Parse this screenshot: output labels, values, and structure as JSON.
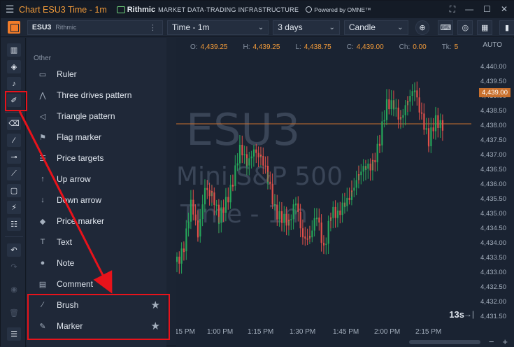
{
  "titlebar": {
    "title": "Chart ESU3 Time - 1m",
    "brand": "Rithmic",
    "brand_sub": "MARKET DATA·TRADING INFRASTRUCTURE",
    "omne": "Powered by OMNE™"
  },
  "toolbar": {
    "symbol": "ESU3",
    "exchange": "Rithmic",
    "timeframe": "Time - 1m",
    "range": "3 days",
    "chart_type": "Candle"
  },
  "panel": {
    "section_label": "Other",
    "items": [
      {
        "label": "Ruler",
        "icon": "ruler-icon",
        "glyph": "▭"
      },
      {
        "label": "Three drives pattern",
        "icon": "three-drives-pattern-icon",
        "glyph": "⋀"
      },
      {
        "label": "Triangle pattern",
        "icon": "triangle-pattern-icon",
        "glyph": "◁"
      },
      {
        "label": "Flag marker",
        "icon": "flag-icon",
        "glyph": "⚑"
      },
      {
        "label": "Price targets",
        "icon": "price-targets-icon",
        "glyph": "☰"
      },
      {
        "label": "Up arrow",
        "icon": "up-arrow-icon",
        "glyph": "↑"
      },
      {
        "label": "Down arrow",
        "icon": "down-arrow-icon",
        "glyph": "↓"
      },
      {
        "label": "Price marker",
        "icon": "price-marker-icon",
        "glyph": "◆"
      },
      {
        "label": "Text",
        "icon": "text-icon",
        "glyph": "T"
      },
      {
        "label": "Note",
        "icon": "note-icon",
        "glyph": "●"
      },
      {
        "label": "Comment",
        "icon": "comment-icon",
        "glyph": "▤"
      },
      {
        "label": "Brush",
        "icon": "brush-icon",
        "glyph": "∕",
        "star": "★"
      },
      {
        "label": "Marker",
        "icon": "marker-icon",
        "glyph": "✎",
        "star": "★"
      }
    ]
  },
  "chart": {
    "watermark_symbol": "ESU3",
    "watermark_name": "Mini S&P 500",
    "watermark_tf": "Time - 1m",
    "ohlc": {
      "o_label": "O:",
      "o": "4,439.25",
      "h_label": "H:",
      "h": "4,439.25",
      "l_label": "L:",
      "l": "4,438.75",
      "c_label": "C:",
      "c": "4,439.00",
      "ch_label": "Ch:",
      "ch": "0.00",
      "tk_label": "Tk:",
      "tk": "5"
    },
    "auto_label": "AUTO",
    "y_ticks": [
      "4,440.00",
      "4,439.50",
      "4,439.00",
      "4,438.50",
      "4,438.00",
      "4,437.50",
      "4,437.00",
      "4,436.50",
      "4,436.00",
      "4,435.50",
      "4,435.00",
      "4,434.50",
      "4,434.00",
      "4,433.50",
      "4,433.00",
      "4,432.50",
      "4,432.00",
      "4,431.50"
    ],
    "current_price": "4,439.00",
    "x_ticks": [
      "15 PM",
      "1:00 PM",
      "1:15 PM",
      "1:30 PM",
      "1:45 PM",
      "2:00 PM",
      "2:15 PM"
    ],
    "timer": "13s",
    "timer_arrow": "→|",
    "zoom_minus": "−",
    "zoom_plus": "+"
  },
  "colors": {
    "up": "#26a65b",
    "down": "#e0504a",
    "accent": "#f29b3a",
    "current_price_bg": "#c9702d",
    "annotation": "#e8131b"
  }
}
